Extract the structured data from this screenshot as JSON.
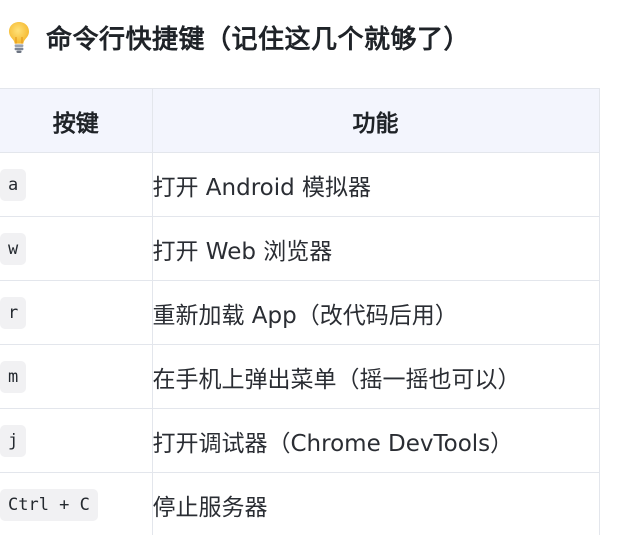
{
  "heading": {
    "icon": "lightbulb-icon",
    "title": "命令行快捷键（记住这几个就够了）"
  },
  "table": {
    "columns": [
      "按键",
      "功能"
    ],
    "rows": [
      {
        "key": "a",
        "action": "打开 Android 模拟器"
      },
      {
        "key": "w",
        "action": "打开 Web 浏览器"
      },
      {
        "key": "r",
        "action": "重新加载 App（改代码后用）"
      },
      {
        "key": "m",
        "action": "在手机上弹出菜单（摇一摇也可以）"
      },
      {
        "key": "j",
        "action": "打开调试器（Chrome DevTools）"
      },
      {
        "key": "Ctrl + C",
        "action": "停止服务器"
      }
    ]
  },
  "colors": {
    "header_bg": "#f3f5fd",
    "border": "#e3e6ec",
    "kbd_bg": "#f1f1f3"
  }
}
